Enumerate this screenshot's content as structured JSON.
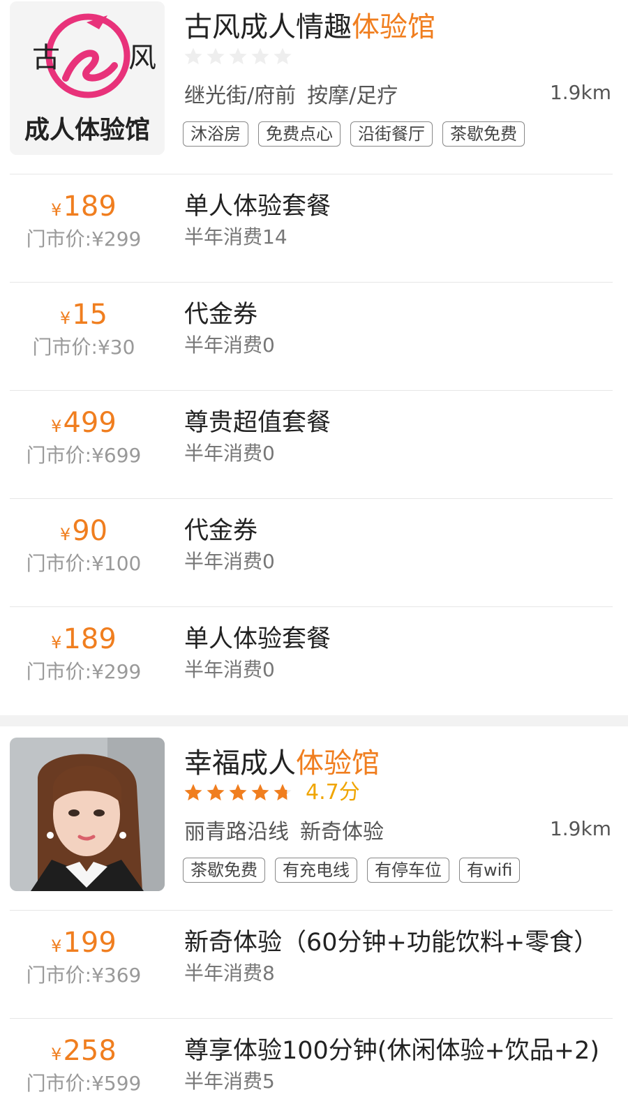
{
  "stores": [
    {
      "title_prefix": "古风成人情趣",
      "title_highlight": "体验馆",
      "rating": 0,
      "rating_text": "",
      "area": "继光街/府前",
      "category": "按摩/足疗",
      "distance": "1.9km",
      "tags": [
        "沐浴房",
        "免费点心",
        "沿街餐厅",
        "茶歇免费"
      ],
      "logo": {
        "left": "古",
        "right": "风",
        "bottom": "成人体验馆"
      },
      "deals": [
        {
          "currency": "¥",
          "price": "189",
          "orig": "门市价:¥299",
          "title": "单人体验套餐",
          "sales": "半年消费14"
        },
        {
          "currency": "¥",
          "price": "15",
          "orig": "门市价:¥30",
          "title": "代金券",
          "sales": "半年消费0"
        },
        {
          "currency": "¥",
          "price": "499",
          "orig": "门市价:¥699",
          "title": "尊贵超值套餐",
          "sales": "半年消费0"
        },
        {
          "currency": "¥",
          "price": "90",
          "orig": "门市价:¥100",
          "title": "代金券",
          "sales": "半年消费0"
        },
        {
          "currency": "¥",
          "price": "189",
          "orig": "门市价:¥299",
          "title": "单人体验套餐",
          "sales": "半年消费0"
        }
      ]
    },
    {
      "title_prefix": "幸福成人",
      "title_highlight": "体验馆",
      "rating": 4.7,
      "rating_text": "4.7分",
      "area": "丽青路沿线",
      "category": "新奇体验",
      "distance": "1.9km",
      "tags": [
        "茶歇免费",
        "有充电线",
        "有停车位",
        "有wifi"
      ],
      "deals": [
        {
          "currency": "¥",
          "price": "199",
          "orig": "门市价:¥369",
          "title": "新奇体验（60分钟+功能饮料+零食）",
          "sales": "半年消费8"
        },
        {
          "currency": "¥",
          "price": "258",
          "orig": "门市价:¥599",
          "title": "尊享体验100分钟(休闲体验+饮品+2)",
          "sales": "半年消费5"
        }
      ]
    }
  ],
  "colors": {
    "accent": "#f07e1f",
    "star_on": "#f07e1f",
    "star_off": "#eeeeee",
    "rating": "#f0a500",
    "logo_pink": "#e8327a"
  }
}
